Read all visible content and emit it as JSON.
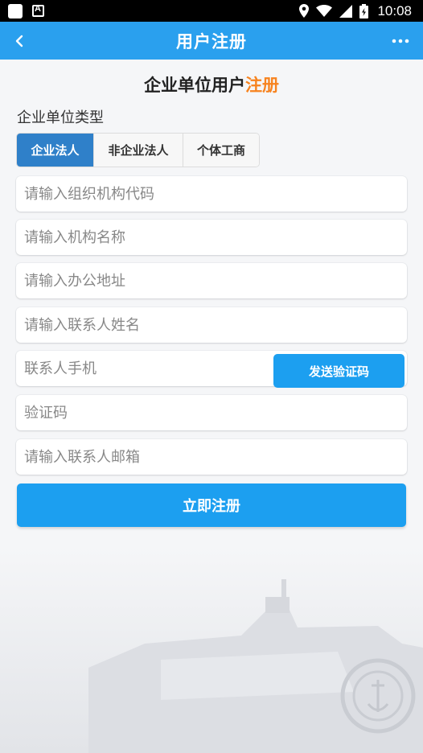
{
  "status_bar": {
    "time": "10:08"
  },
  "header": {
    "title": "用户注册"
  },
  "form": {
    "heading_main": "企业单位用户",
    "heading_accent": "注册",
    "type_label": "企业单位类型",
    "types": [
      {
        "label": "企业法人",
        "active": true
      },
      {
        "label": "非企业法人",
        "active": false
      },
      {
        "label": "个体工商",
        "active": false
      }
    ],
    "fields": {
      "org_code": {
        "placeholder": "请输入组织机构代码",
        "value": ""
      },
      "org_name": {
        "placeholder": "请输入机构名称",
        "value": ""
      },
      "office_address": {
        "placeholder": "请输入办公地址",
        "value": ""
      },
      "contact_name": {
        "placeholder": "请输入联系人姓名",
        "value": ""
      },
      "contact_phone": {
        "placeholder": "联系人手机",
        "value": ""
      },
      "verify_code": {
        "placeholder": "验证码",
        "value": ""
      },
      "contact_email": {
        "placeholder": "请输入联系人邮箱",
        "value": ""
      }
    },
    "send_code_label": "发送验证码",
    "submit_label": "立即注册"
  },
  "colors": {
    "primary": "#2aa0ee",
    "accent": "#f7831f",
    "active_tab": "#2f80c9"
  },
  "icons": [
    "back-arrow-icon",
    "more-dots-icon",
    "location-icon",
    "wifi-icon",
    "signal-icon",
    "battery-icon"
  ]
}
